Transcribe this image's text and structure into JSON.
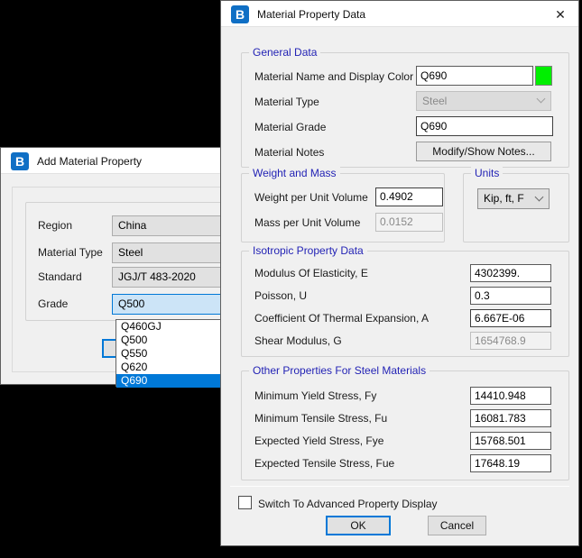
{
  "left_dialog": {
    "title": "Add Material Property",
    "icon_letter": "B",
    "fields": {
      "region_label": "Region",
      "region_value": "China",
      "type_label": "Material Type",
      "type_value": "Steel",
      "standard_label": "Standard",
      "standard_value": "JGJ/T 483-2020",
      "grade_label": "Grade",
      "grade_value": "Q500"
    },
    "grade_dropdown": {
      "options": [
        "Q460GJ",
        "Q500",
        "Q550",
        "Q620",
        "Q690"
      ],
      "highlighted": "Q690"
    }
  },
  "right_dialog": {
    "title": "Material Property Data",
    "close_glyph": "✕",
    "general": {
      "legend": "General Data",
      "name_label": "Material Name and Display Color",
      "name_value": "Q690",
      "display_color": "#00ef00",
      "type_label": "Material Type",
      "type_value": "Steel",
      "grade_label": "Material Grade",
      "grade_value": "Q690",
      "notes_label": "Material Notes",
      "notes_button": "Modify/Show Notes..."
    },
    "weight_mass": {
      "legend": "Weight and Mass",
      "weight_label": "Weight per Unit Volume",
      "weight_value": "0.4902",
      "mass_label": "Mass per Unit Volume",
      "mass_value": "0.0152"
    },
    "units": {
      "legend": "Units",
      "selected": "Kip, ft, F"
    },
    "isotropic": {
      "legend": "Isotropic Property Data",
      "rows": [
        {
          "label": "Modulus Of Elasticity,  E",
          "value": "4302399."
        },
        {
          "label": "Poisson, U",
          "value": "0.3"
        },
        {
          "label": "Coefficient Of Thermal Expansion,  A",
          "value": "6.667E-06"
        },
        {
          "label": "Shear Modulus,  G",
          "value": "1654768.9"
        }
      ]
    },
    "other": {
      "legend": "Other Properties For Steel Materials",
      "rows": [
        {
          "label": "Minimum Yield Stress, Fy",
          "value": "14410.948"
        },
        {
          "label": "Minimum Tensile Stress, Fu",
          "value": "16081.783"
        },
        {
          "label": "Expected Yield Stress, Fye",
          "value": "15768.501"
        },
        {
          "label": "Expected Tensile Stress, Fue",
          "value": "17648.19"
        }
      ]
    },
    "advanced_checkbox_label": "Switch To Advanced Property Display",
    "ok_label": "OK",
    "cancel_label": "Cancel"
  }
}
